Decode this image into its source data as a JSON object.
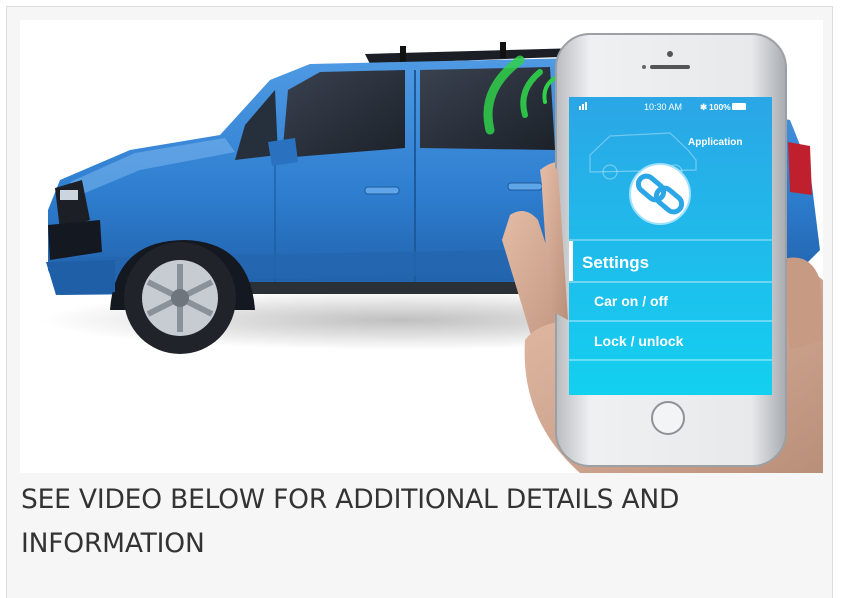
{
  "caption": "SEE VIDEO BELOW FOR ADDITIONAL DETAILS AND INFORMATION",
  "phone": {
    "status_time": "10:30 AM",
    "status_battery": "100%",
    "app_label": "Application",
    "settings_label": "Settings",
    "menu_items": [
      {
        "label": "Car on / off"
      },
      {
        "label": "Lock / unlock"
      }
    ]
  },
  "colors": {
    "car_body": "#2f7fd1",
    "screen_top": "#2ba6e6",
    "screen_bottom": "#13d0f0",
    "signal_arcs": "#2fd04a",
    "caption_text": "#333333"
  },
  "icons": [
    "wifi-signal-icon",
    "bluetooth-icon",
    "battery-icon",
    "chain-link-icon",
    "suv-outline-icon"
  ]
}
